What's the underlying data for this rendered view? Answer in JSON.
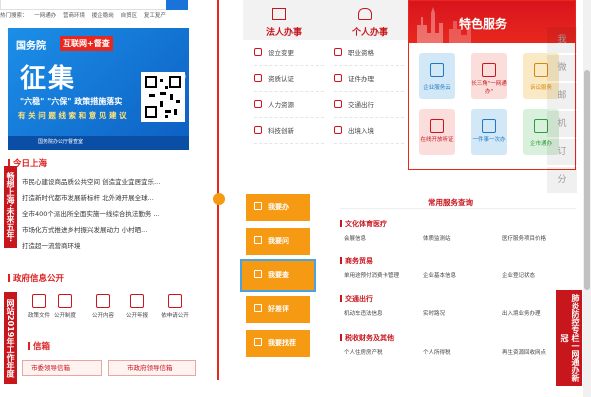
{
  "hot_links": [
    "热门搜索：",
    "一网通办",
    "营商环境",
    "援企稳岗",
    "自贸区",
    "复工复产"
  ],
  "banner": {
    "brand": "国务院",
    "tag": "互联网+督查",
    "title": "征集",
    "line1": "\"六稳\" \"六保\" 政策措施落实",
    "line2": "有 关 问 题 线 索 和 意 见 建 议",
    "footer_brand": "国务院办公厅督查室"
  },
  "today": {
    "title": "今日上海",
    "side_label": "畅想上海·未来五年·听你说",
    "items": [
      "市民心建设商品质公共空间 创造宜业宜居宜乐...",
      "打造新时代都市发展新标杆 北外滩开展全球...",
      "全市400个派出所全面实施一线综合执法勤务 ...",
      "市场化方式推进乡村振兴发展动力 小村晒...",
      "打造超一流营商环境"
    ]
  },
  "gov": {
    "title": "政府信息公开",
    "side_label": "网站2019年工作年度报表",
    "items": [
      "政策文件",
      "公开制度",
      "公开内容",
      "公开年报",
      "依申请公开"
    ],
    "mailbox_title": "信箱",
    "mailbox_btn1": "市委领导信箱",
    "mailbox_btn2": "市政府领导信箱"
  },
  "tabs": {
    "legal": "法人办事",
    "personal": "个人办事",
    "legal_items": [
      "设立变更",
      "资质认证",
      "人力资源",
      "科技创新"
    ],
    "personal_items": [
      "职业资格",
      "证件办理",
      "交通出行",
      "出境入境"
    ]
  },
  "special": {
    "title": "特色服务",
    "cards": [
      {
        "label": "企业服务云",
        "color": "blue"
      },
      {
        "label": "长三角\"一网通办\"",
        "color": "pink"
      },
      {
        "label": "诉讼服务",
        "color": "yellow"
      },
      {
        "label": "在线开放听证",
        "color": "pink"
      },
      {
        "label": "一件事一次办",
        "color": "blue"
      },
      {
        "label": "企市通办",
        "color": "green"
      }
    ]
  },
  "tools": [
    "我",
    "微",
    "邮",
    "机",
    "订",
    "分"
  ],
  "actions": [
    {
      "label": "我要办",
      "selected": false
    },
    {
      "label": "我要问",
      "selected": false
    },
    {
      "label": "我要查",
      "selected": true
    },
    {
      "label": "好差评",
      "selected": false
    },
    {
      "label": "我要找茬",
      "selected": false
    }
  ],
  "services": {
    "title": "常用服务查询",
    "categories": [
      {
        "name": "文化体育医疗",
        "items": [
          "会展信息",
          "体质监测站",
          "医疗服务项目价格"
        ]
      },
      {
        "name": "商务贸易",
        "items": [
          "单用途预付消费卡管理",
          "企业基本信息",
          "企业登记状态"
        ]
      },
      {
        "name": "交通出行",
        "items": [
          "机动车违法信息",
          "实时路况",
          "出入境业务办理"
        ]
      },
      {
        "name": "税收财务及其他",
        "items": [
          "个人住房房产税",
          "个人所得税",
          "再生资源回收网点"
        ]
      }
    ]
  },
  "covid": "肺炎防控专栏一网通办新冠"
}
